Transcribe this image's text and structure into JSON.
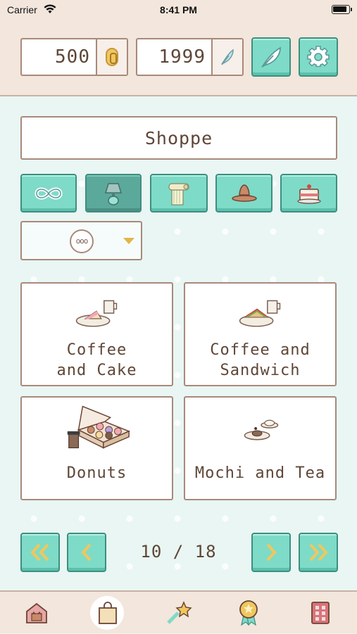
{
  "status_bar": {
    "carrier": "Carrier",
    "time": "8:41 PM"
  },
  "currency": {
    "coins": {
      "value": "500",
      "icon": "coin-icon"
    },
    "feathers": {
      "value": "1999",
      "icon": "feather-icon"
    }
  },
  "header_buttons": {
    "feather_button_icon": "feather-icon",
    "settings_button_icon": "gear-icon"
  },
  "shop": {
    "title": "Shoppe"
  },
  "category_tabs": [
    {
      "icon": "infinity-icon",
      "active": false
    },
    {
      "icon": "lamp-icon",
      "active": true
    },
    {
      "icon": "scroll-icon",
      "active": false
    },
    {
      "icon": "hat-icon",
      "active": false
    },
    {
      "icon": "cake-icon",
      "active": false
    }
  ],
  "filter": {
    "badge": "ooo",
    "arrow_icon": "triangle-down-icon"
  },
  "items": [
    {
      "label": "Coffee\nand Cake",
      "icon": "coffee-cake-icon"
    },
    {
      "label": "Coffee and\nSandwich",
      "icon": "coffee-sandwich-icon"
    },
    {
      "label": "Donuts",
      "icon": "donut-box-icon"
    },
    {
      "label": "Mochi and Tea",
      "icon": "mochi-tea-icon"
    }
  ],
  "pagination": {
    "indicator": "10 / 18",
    "current": 10,
    "total": 18,
    "first_icon": "double-chevron-left-icon",
    "prev_icon": "chevron-left-icon",
    "next_icon": "chevron-right-icon",
    "last_icon": "double-chevron-right-icon"
  },
  "bottom_nav": [
    {
      "icon": "house-icon",
      "selected": false
    },
    {
      "icon": "shopping-bag-icon",
      "selected": true
    },
    {
      "icon": "shooting-star-icon",
      "selected": false
    },
    {
      "icon": "medal-icon",
      "selected": false
    },
    {
      "icon": "album-icon",
      "selected": false
    }
  ],
  "colors": {
    "teal": "#7edbc7",
    "teal_active": "#5ba99b",
    "border_brown": "#a8897a",
    "text_brown": "#5e4637",
    "cream": "#f3e6dc",
    "mint_bg": "#e9f6f3"
  }
}
